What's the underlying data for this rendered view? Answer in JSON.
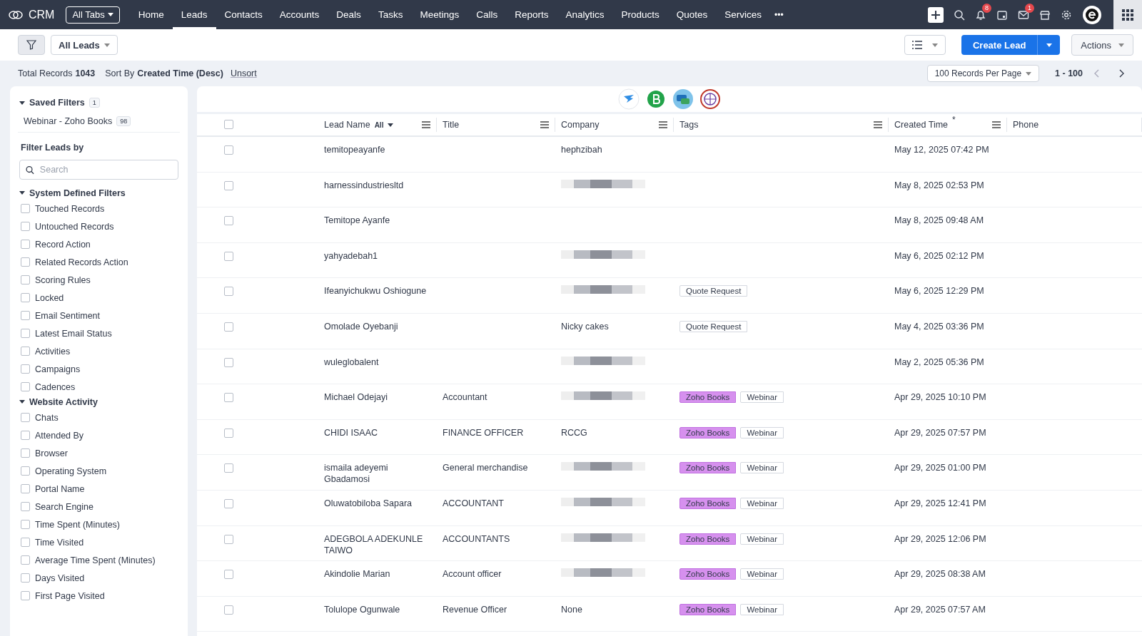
{
  "nav": {
    "brand": "CRM",
    "all_tabs": "All Tabs",
    "tabs": [
      {
        "label": "Home",
        "selected": false
      },
      {
        "label": "Leads",
        "selected": true
      },
      {
        "label": "Contacts",
        "selected": false
      },
      {
        "label": "Accounts",
        "selected": false
      },
      {
        "label": "Deals",
        "selected": false
      },
      {
        "label": "Tasks",
        "selected": false
      },
      {
        "label": "Meetings",
        "selected": false
      },
      {
        "label": "Calls",
        "selected": false
      },
      {
        "label": "Reports",
        "selected": false
      },
      {
        "label": "Analytics",
        "selected": false
      },
      {
        "label": "Products",
        "selected": false
      },
      {
        "label": "Quotes",
        "selected": false
      },
      {
        "label": "Services",
        "selected": false
      }
    ],
    "more": "•••",
    "notification_count": "8",
    "mail_count": "1"
  },
  "toolbar": {
    "view": "All Leads",
    "create": "Create Lead",
    "actions": "Actions"
  },
  "summary": {
    "total_label": "Total Records",
    "total": "1043",
    "sort_label": "Sort By",
    "sort": "Created Time (Desc)",
    "unsort": "Unsort",
    "per_page": "100 Records Per Page",
    "range": "1 - 100"
  },
  "sidebar": {
    "saved_title": "Saved Filters",
    "saved_count": "1",
    "saved": [
      {
        "label": "Webinar - Zoho Books",
        "count": "98"
      }
    ],
    "filter_title": "Filter Leads by",
    "search_placeholder": "Search",
    "groups": [
      {
        "title": "System Defined Filters",
        "expanded": true,
        "items": [
          {
            "label": "Touched Records",
            "checked": false
          },
          {
            "label": "Untouched Records",
            "checked": false
          },
          {
            "label": "Record Action",
            "checked": false
          },
          {
            "label": "Related Records Action",
            "checked": false
          },
          {
            "label": "Scoring Rules",
            "checked": false
          },
          {
            "label": "Locked",
            "checked": false
          },
          {
            "label": "Email Sentiment",
            "checked": false
          },
          {
            "label": "Latest Email Status",
            "checked": false
          },
          {
            "label": "Activities",
            "checked": false
          },
          {
            "label": "Campaigns",
            "checked": false
          },
          {
            "label": "Cadences",
            "checked": false
          }
        ]
      },
      {
        "title": "Website Activity",
        "expanded": true,
        "items": [
          {
            "label": "Chats",
            "checked": false
          },
          {
            "label": "Attended By",
            "checked": false
          },
          {
            "label": "Browser",
            "checked": false
          },
          {
            "label": "Operating System",
            "checked": false
          },
          {
            "label": "Portal Name",
            "checked": false
          },
          {
            "label": "Search Engine",
            "checked": false
          },
          {
            "label": "Time Spent (Minutes)",
            "checked": false
          },
          {
            "label": "Time Visited",
            "checked": false
          },
          {
            "label": "Average Time Spent (Minutes)",
            "checked": false
          },
          {
            "label": "Days Visited",
            "checked": false
          },
          {
            "label": "First Page Visited",
            "checked": false
          }
        ]
      }
    ]
  },
  "table": {
    "select_all_checked": false,
    "columns": [
      {
        "label": "Lead Name",
        "filter": "All"
      },
      {
        "label": "Title"
      },
      {
        "label": "Company"
      },
      {
        "label": "Tags"
      },
      {
        "label": "Created Time",
        "sorted": true,
        "sort_mark": "*"
      },
      {
        "label": "Phone"
      }
    ],
    "rows": [
      {
        "checked": false,
        "name": "temitopeayanfe",
        "title": "",
        "company": "hephzibah",
        "company_redacted": false,
        "tags": [],
        "created": "May 12, 2025 07:42 PM"
      },
      {
        "checked": false,
        "name": "harnessindustriesltd",
        "title": "",
        "company": "",
        "company_redacted": true,
        "tags": [],
        "created": "May 8, 2025 02:53 PM"
      },
      {
        "checked": false,
        "name": "Temitope Ayanfe",
        "title": "",
        "company": "",
        "company_redacted": false,
        "tags": [],
        "created": "May 8, 2025 09:48 AM"
      },
      {
        "checked": false,
        "name": "yahyadebah1",
        "title": "",
        "company": "",
        "company_redacted": true,
        "tags": [],
        "created": "May 6, 2025 02:12 PM"
      },
      {
        "checked": false,
        "name": "Ifeanyichukwu Oshiogune",
        "title": "",
        "company": "",
        "company_redacted": true,
        "tags": [
          {
            "label": "Quote Request",
            "color": "#ffffff"
          }
        ],
        "created": "May 6, 2025 12:29 PM"
      },
      {
        "checked": false,
        "name": "Omolade Oyebanji",
        "title": "",
        "company": "Nicky cakes",
        "company_redacted": false,
        "tags": [
          {
            "label": "Quote Request",
            "color": "#ffffff"
          }
        ],
        "created": "May 4, 2025 03:36 PM"
      },
      {
        "checked": false,
        "name": "wuleglobalent",
        "title": "",
        "company": "",
        "company_redacted": true,
        "tags": [],
        "created": "May 2, 2025 05:36 PM"
      },
      {
        "checked": false,
        "name": "Michael Odejayi",
        "title": "Accountant",
        "company": "",
        "company_redacted": true,
        "tags": [
          {
            "label": "Zoho Books",
            "color": "#d690ee"
          },
          {
            "label": "Webinar",
            "color": "#ffffff"
          }
        ],
        "created": "Apr 29, 2025 10:10 PM"
      },
      {
        "checked": false,
        "name": "CHIDI ISAAC",
        "title": "FINANCE OFFICER",
        "company": "RCCG",
        "company_redacted": false,
        "tags": [
          {
            "label": "Zoho Books",
            "color": "#d690ee"
          },
          {
            "label": "Webinar",
            "color": "#ffffff"
          }
        ],
        "created": "Apr 29, 2025 07:57 PM"
      },
      {
        "checked": false,
        "name": "ismaila adeyemi Gbadamosi",
        "title": "General merchandise",
        "company": "",
        "company_redacted": true,
        "tags": [
          {
            "label": "Zoho Books",
            "color": "#d690ee"
          },
          {
            "label": "Webinar",
            "color": "#ffffff"
          }
        ],
        "created": "Apr 29, 2025 01:00 PM"
      },
      {
        "checked": false,
        "name": "Oluwatobiloba Sapara",
        "title": "ACCOUNTANT",
        "company": "",
        "company_redacted": true,
        "tags": [
          {
            "label": "Zoho Books",
            "color": "#d690ee"
          },
          {
            "label": "Webinar",
            "color": "#ffffff"
          }
        ],
        "created": "Apr 29, 2025 12:41 PM"
      },
      {
        "checked": false,
        "name": "ADEGBOLA ADEKUNLE TAIWO",
        "title": "ACCOUNTANTS",
        "company": "",
        "company_redacted": true,
        "tags": [
          {
            "label": "Zoho Books",
            "color": "#d690ee"
          },
          {
            "label": "Webinar",
            "color": "#ffffff"
          }
        ],
        "created": "Apr 29, 2025 12:06 PM"
      },
      {
        "checked": false,
        "name": "Akindolie Marian",
        "title": "Account officer",
        "company": "",
        "company_redacted": true,
        "tags": [
          {
            "label": "Zoho Books",
            "color": "#d690ee"
          },
          {
            "label": "Webinar",
            "color": "#ffffff"
          }
        ],
        "created": "Apr 29, 2025 08:38 AM"
      },
      {
        "checked": false,
        "name": "Tolulope Ogunwale",
        "title": "Revenue Officer",
        "company": "None",
        "company_redacted": false,
        "tags": [
          {
            "label": "Zoho Books",
            "color": "#d690ee"
          },
          {
            "label": "Webinar",
            "color": "#ffffff"
          }
        ],
        "created": "Apr 29, 2025 07:57 AM"
      }
    ]
  }
}
